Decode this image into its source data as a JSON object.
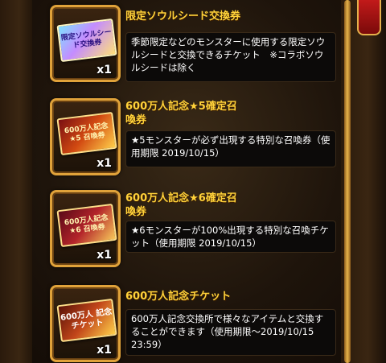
{
  "items": [
    {
      "title": "限定ソウルシード交換券",
      "description": "季節限定などのモンスターに使用する限定ソウルシードと交換できるチケット　※コラボソウルシードは除く",
      "quantity": "x1",
      "ticket_text": "限定ソウルシード交換券",
      "ticket_icon": "limited-soul-seed-ticket"
    },
    {
      "title": "600万人記念★5確定召喚券",
      "description": "★5モンスターが必ず出現する特別な召喚券（使用期限 2019/10/15）",
      "quantity": "x1",
      "ticket_text": "600万人記念 ★5 召喚券",
      "ticket_icon": "star5-summon-ticket"
    },
    {
      "title": "600万人記念★6確定召喚券",
      "description": "★6モンスターが100%出現する特別な召喚チケット（使用期限 2019/10/15）",
      "quantity": "x1",
      "ticket_text": "600万人記念 ★6 召喚券",
      "ticket_icon": "star6-summon-ticket"
    },
    {
      "title": "600万人記念チケット",
      "description": "600万人記念交換所で様々なアイテムと交換することができます（使用期限〜2019/10/15 23:59）",
      "quantity": "x1",
      "ticket_text": "600万人 記念チケット",
      "ticket_icon": "6m-commemorative-ticket"
    }
  ],
  "colors": {
    "title": "#ffd23a",
    "frame": "#e0a23a",
    "scroll_thumb": "#c21a1a"
  }
}
